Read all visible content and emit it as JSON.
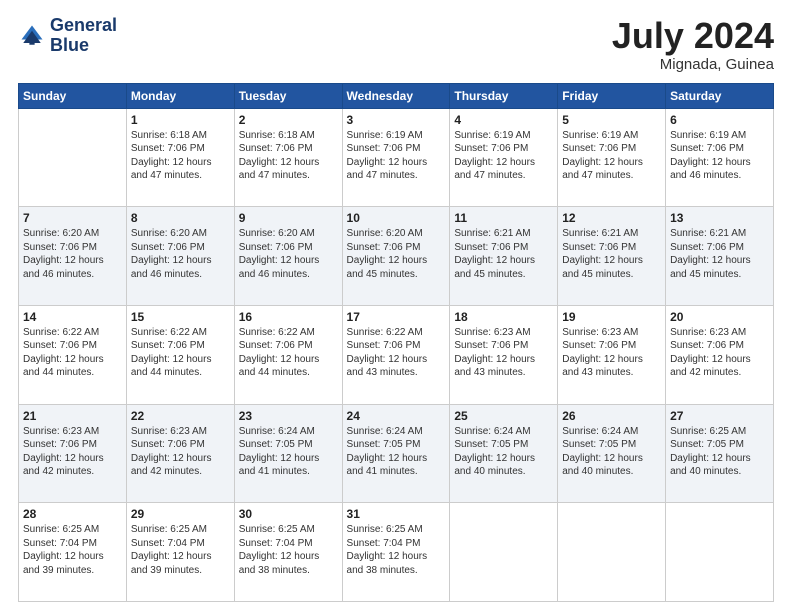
{
  "logo": {
    "line1": "General",
    "line2": "Blue"
  },
  "title": "July 2024",
  "location": "Mignada, Guinea",
  "weekdays": [
    "Sunday",
    "Monday",
    "Tuesday",
    "Wednesday",
    "Thursday",
    "Friday",
    "Saturday"
  ],
  "weeks": [
    [
      {
        "day": "",
        "info": ""
      },
      {
        "day": "1",
        "info": "Sunrise: 6:18 AM\nSunset: 7:06 PM\nDaylight: 12 hours\nand 47 minutes."
      },
      {
        "day": "2",
        "info": "Sunrise: 6:18 AM\nSunset: 7:06 PM\nDaylight: 12 hours\nand 47 minutes."
      },
      {
        "day": "3",
        "info": "Sunrise: 6:19 AM\nSunset: 7:06 PM\nDaylight: 12 hours\nand 47 minutes."
      },
      {
        "day": "4",
        "info": "Sunrise: 6:19 AM\nSunset: 7:06 PM\nDaylight: 12 hours\nand 47 minutes."
      },
      {
        "day": "5",
        "info": "Sunrise: 6:19 AM\nSunset: 7:06 PM\nDaylight: 12 hours\nand 47 minutes."
      },
      {
        "day": "6",
        "info": "Sunrise: 6:19 AM\nSunset: 7:06 PM\nDaylight: 12 hours\nand 46 minutes."
      }
    ],
    [
      {
        "day": "7",
        "info": ""
      },
      {
        "day": "8",
        "info": "Sunrise: 6:20 AM\nSunset: 7:06 PM\nDaylight: 12 hours\nand 46 minutes."
      },
      {
        "day": "9",
        "info": "Sunrise: 6:20 AM\nSunset: 7:06 PM\nDaylight: 12 hours\nand 46 minutes."
      },
      {
        "day": "10",
        "info": "Sunrise: 6:20 AM\nSunset: 7:06 PM\nDaylight: 12 hours\nand 45 minutes."
      },
      {
        "day": "11",
        "info": "Sunrise: 6:21 AM\nSunset: 7:06 PM\nDaylight: 12 hours\nand 45 minutes."
      },
      {
        "day": "12",
        "info": "Sunrise: 6:21 AM\nSunset: 7:06 PM\nDaylight: 12 hours\nand 45 minutes."
      },
      {
        "day": "13",
        "info": "Sunrise: 6:21 AM\nSunset: 7:06 PM\nDaylight: 12 hours\nand 45 minutes."
      }
    ],
    [
      {
        "day": "14",
        "info": ""
      },
      {
        "day": "15",
        "info": "Sunrise: 6:22 AM\nSunset: 7:06 PM\nDaylight: 12 hours\nand 44 minutes."
      },
      {
        "day": "16",
        "info": "Sunrise: 6:22 AM\nSunset: 7:06 PM\nDaylight: 12 hours\nand 44 minutes."
      },
      {
        "day": "17",
        "info": "Sunrise: 6:22 AM\nSunset: 7:06 PM\nDaylight: 12 hours\nand 43 minutes."
      },
      {
        "day": "18",
        "info": "Sunrise: 6:23 AM\nSunset: 7:06 PM\nDaylight: 12 hours\nand 43 minutes."
      },
      {
        "day": "19",
        "info": "Sunrise: 6:23 AM\nSunset: 7:06 PM\nDaylight: 12 hours\nand 43 minutes."
      },
      {
        "day": "20",
        "info": "Sunrise: 6:23 AM\nSunset: 7:06 PM\nDaylight: 12 hours\nand 42 minutes."
      }
    ],
    [
      {
        "day": "21",
        "info": ""
      },
      {
        "day": "22",
        "info": "Sunrise: 6:23 AM\nSunset: 7:06 PM\nDaylight: 12 hours\nand 42 minutes."
      },
      {
        "day": "23",
        "info": "Sunrise: 6:24 AM\nSunset: 7:05 PM\nDaylight: 12 hours\nand 41 minutes."
      },
      {
        "day": "24",
        "info": "Sunrise: 6:24 AM\nSunset: 7:05 PM\nDaylight: 12 hours\nand 41 minutes."
      },
      {
        "day": "25",
        "info": "Sunrise: 6:24 AM\nSunset: 7:05 PM\nDaylight: 12 hours\nand 40 minutes."
      },
      {
        "day": "26",
        "info": "Sunrise: 6:24 AM\nSunset: 7:05 PM\nDaylight: 12 hours\nand 40 minutes."
      },
      {
        "day": "27",
        "info": "Sunrise: 6:25 AM\nSunset: 7:05 PM\nDaylight: 12 hours\nand 40 minutes."
      }
    ],
    [
      {
        "day": "28",
        "info": "Sunrise: 6:25 AM\nSunset: 7:04 PM\nDaylight: 12 hours\nand 39 minutes."
      },
      {
        "day": "29",
        "info": "Sunrise: 6:25 AM\nSunset: 7:04 PM\nDaylight: 12 hours\nand 39 minutes."
      },
      {
        "day": "30",
        "info": "Sunrise: 6:25 AM\nSunset: 7:04 PM\nDaylight: 12 hours\nand 38 minutes."
      },
      {
        "day": "31",
        "info": "Sunrise: 6:25 AM\nSunset: 7:04 PM\nDaylight: 12 hours\nand 38 minutes."
      },
      {
        "day": "",
        "info": ""
      },
      {
        "day": "",
        "info": ""
      },
      {
        "day": "",
        "info": ""
      }
    ]
  ],
  "week7_sunday": "Sunrise: 6:20 AM\nSunset: 7:06 PM\nDaylight: 12 hours\nand 46 minutes.",
  "week14_sunday": "Sunrise: 6:22 AM\nSunset: 7:06 PM\nDaylight: 12 hours\nand 44 minutes.",
  "week21_sunday": "Sunrise: 6:23 AM\nSunset: 7:06 PM\nDaylight: 12 hours\nand 42 minutes."
}
